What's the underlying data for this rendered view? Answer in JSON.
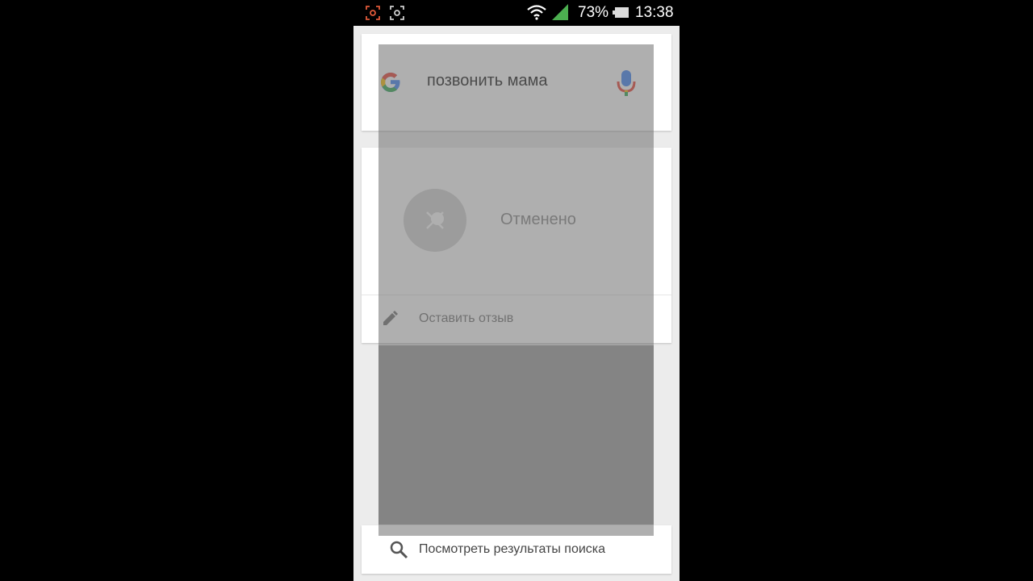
{
  "status_bar": {
    "battery_percent": "73%",
    "time": "13:38",
    "icons": [
      "screenshot-icon",
      "screenshot-icon",
      "wifi-icon",
      "signal-icon",
      "battery-icon"
    ]
  },
  "search": {
    "query": "позвонить мама",
    "icons": [
      "google-logo-icon",
      "mic-icon"
    ]
  },
  "result": {
    "status_text": "Отменено",
    "feedback_label": "Оставить отзыв",
    "icons": [
      "cancel-mic-icon",
      "pencil-icon"
    ]
  },
  "bottom": {
    "label": "Посмотреть результаты поиска",
    "icons": [
      "search-icon"
    ]
  },
  "colors": {
    "google_blue": "#4285f4",
    "google_red": "#ea4335",
    "google_yellow": "#fbbc05",
    "google_green": "#34a853",
    "signal_green": "#4caf50"
  }
}
